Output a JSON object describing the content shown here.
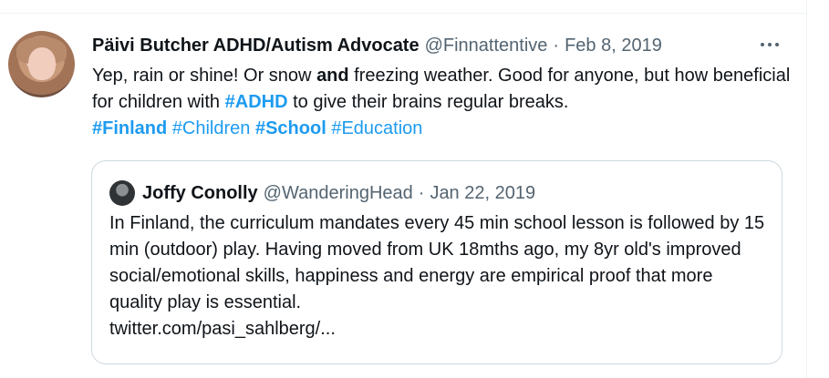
{
  "tweet": {
    "author": "Päivi Butcher ADHD/Autism Advocate",
    "handle": "@Finnattentive",
    "separator": "·",
    "date": "Feb 8, 2019",
    "text": {
      "part1": "Yep, rain or shine! Or snow ",
      "bold1": "and",
      "part2": " freezing weather. Good for anyone, but how beneficial for children with ",
      "hashtag_adhd": "#ADHD",
      "part3": " to give their brains regular breaks.",
      "hashtag_finland": "#Finland",
      "hashtag_children": "#Children",
      "hashtag_school": "#School",
      "hashtag_education": "#Education"
    },
    "more_icon": "more-horizontal-icon"
  },
  "quote": {
    "author": "Joffy Conolly",
    "handle": "@WanderingHead",
    "separator": "·",
    "date": "Jan 22, 2019",
    "text": "In Finland, the curriculum mandates every 45 min school lesson is followed by 15 min (outdoor) play. Having moved from UK 18mths ago, my 8yr old's improved social/emotional skills, happiness and energy are empirical proof that more quality play is essential.",
    "link": "twitter.com/pasi_sahlberg/..."
  },
  "colors": {
    "text": "#0f1419",
    "muted": "#536471",
    "link": "#1d9bf0",
    "border": "#cfd9de"
  }
}
